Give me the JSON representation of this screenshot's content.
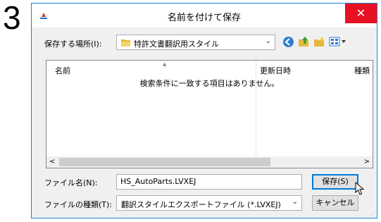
{
  "step_number": "3",
  "dialog": {
    "title": "名前を付けて保存",
    "close_glyph": "✕"
  },
  "location": {
    "label": "保存する場所(I):",
    "value": "特許文書翻訳用スタイル"
  },
  "list": {
    "columns": [
      "名前",
      "更新日時",
      "種類"
    ],
    "empty_message": "検索条件に一致する項目はありません。"
  },
  "filename": {
    "label": "ファイル名(N):",
    "value": "HS_AutoParts.LVXEJ"
  },
  "filetype": {
    "label": "ファイルの種類(T):",
    "value": "翻訳スタイルエクスポートファイル (*.LVXEJ)"
  },
  "buttons": {
    "save": "保存(S)",
    "cancel": "キャンセル"
  },
  "colors": {
    "accent": "#0078d7",
    "close": "#e81123"
  }
}
